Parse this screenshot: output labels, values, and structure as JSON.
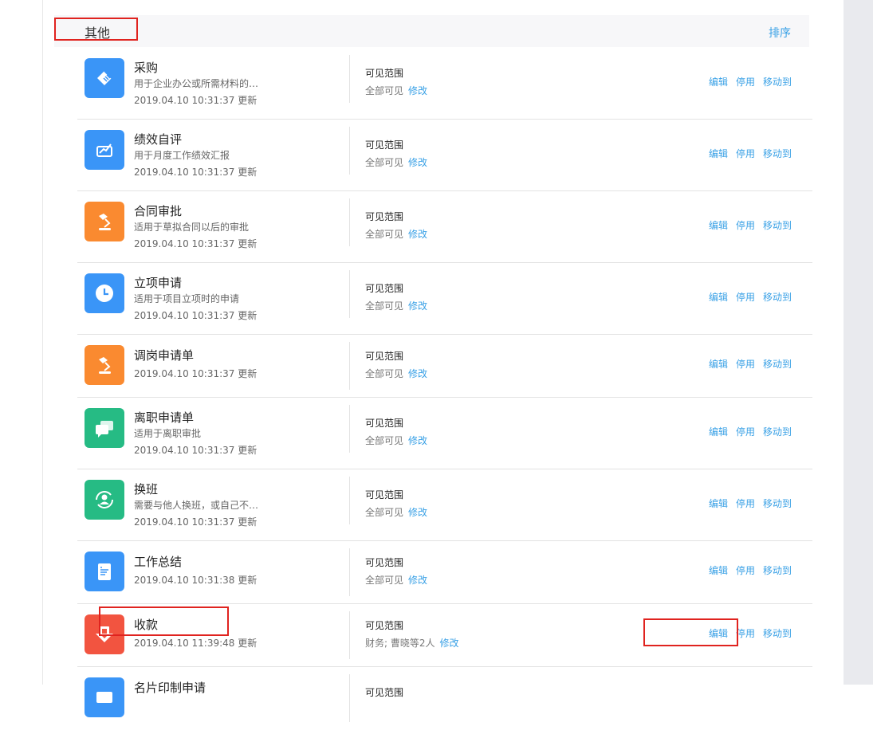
{
  "group": {
    "title": "其他",
    "sort_label": "排序"
  },
  "visibility_label": "可见范围",
  "modify_label": "修改",
  "actions": {
    "edit": "编辑",
    "disable": "停用",
    "move": "移动到"
  },
  "items": [
    {
      "name": "采购",
      "desc": "用于企业办公或所需材料的…",
      "time": "2019.04.10 10:31:37 更新",
      "visibility": "全部可见",
      "icon": "purchase-tag-icon",
      "color": "#3a95f7"
    },
    {
      "name": "绩效自评",
      "desc": "用于月度工作绩效汇报",
      "time": "2019.04.10 10:31:37 更新",
      "visibility": "全部可见",
      "icon": "performance-chart-icon",
      "color": "#3a95f7"
    },
    {
      "name": "合同审批",
      "desc": "适用于草拟合同以后的审批",
      "time": "2019.04.10 10:31:37 更新",
      "visibility": "全部可见",
      "icon": "stamp-icon",
      "color": "#fa8a30"
    },
    {
      "name": "立项申请",
      "desc": "适用于项目立项时的申请",
      "time": "2019.04.10 10:31:37 更新",
      "visibility": "全部可见",
      "icon": "clock-icon",
      "color": "#3a95f7"
    },
    {
      "name": "调岗申请单",
      "desc": "",
      "time": "2019.04.10 10:31:37 更新",
      "visibility": "全部可见",
      "icon": "stamp-icon",
      "color": "#fa8a30"
    },
    {
      "name": "离职申请单",
      "desc": "适用于离职审批",
      "time": "2019.04.10 10:31:37 更新",
      "visibility": "全部可见",
      "icon": "chat-bubbles-icon",
      "color": "#26bb84"
    },
    {
      "name": "换班",
      "desc": "需要与他人换班，或自己不…",
      "time": "2019.04.10 10:31:37 更新",
      "visibility": "全部可见",
      "icon": "user-swap-icon",
      "color": "#26bb84"
    },
    {
      "name": "工作总结",
      "desc": "",
      "time": "2019.04.10 10:31:38 更新",
      "visibility": "全部可见",
      "icon": "document-icon",
      "color": "#3a95f7"
    },
    {
      "name": "收款",
      "desc": "",
      "time": "2019.04.10 11:39:48 更新",
      "visibility": "财务; 曹晓等2人",
      "icon": "receive-payment-icon",
      "color": "#f25440"
    },
    {
      "name": "名片印制申请",
      "desc": "",
      "time": "",
      "visibility": "",
      "icon": "card-icon",
      "color": "#3a95f7"
    }
  ]
}
